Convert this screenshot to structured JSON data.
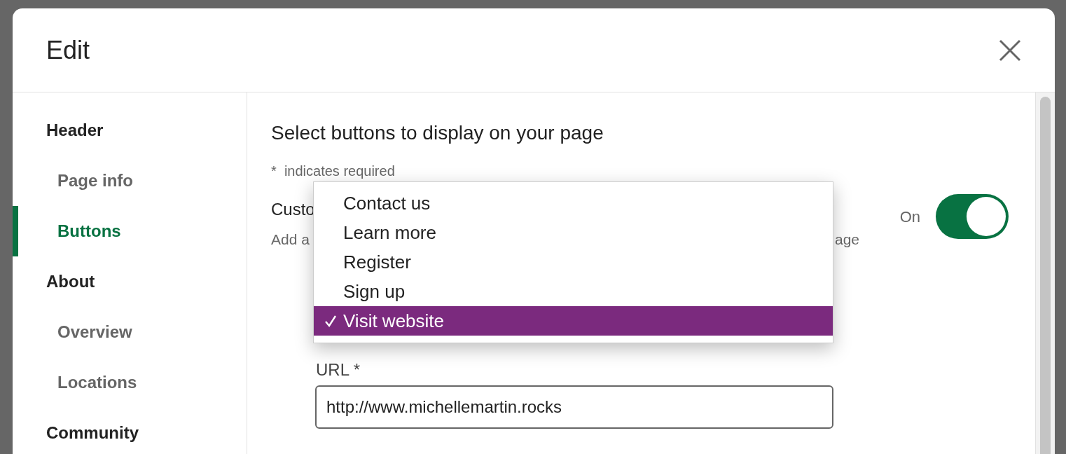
{
  "dialog": {
    "title": "Edit"
  },
  "sidebar": {
    "sections": [
      {
        "label": "Header",
        "children": [
          {
            "label": "Page info",
            "selected": false
          },
          {
            "label": "Buttons",
            "selected": true
          }
        ]
      },
      {
        "label": "About",
        "children": [
          {
            "label": "Overview",
            "selected": false
          },
          {
            "label": "Locations",
            "selected": false
          }
        ]
      },
      {
        "label": "Community"
      }
    ]
  },
  "content": {
    "heading": "Select buttons to display on your page",
    "required_note": "*  indicates required",
    "custom_button": {
      "label": "Custo",
      "description_start": "Add a",
      "description_end": "age",
      "toggle": {
        "label": "On",
        "on": true
      }
    },
    "dropdown": {
      "options": [
        {
          "label": "Contact us",
          "selected": false
        },
        {
          "label": "Learn more",
          "selected": false
        },
        {
          "label": "Register",
          "selected": false
        },
        {
          "label": "Sign up",
          "selected": false
        },
        {
          "label": "Visit website",
          "selected": true
        }
      ]
    },
    "url_field": {
      "label": "URL *",
      "value": "http://www.michellemartin.rocks"
    }
  }
}
